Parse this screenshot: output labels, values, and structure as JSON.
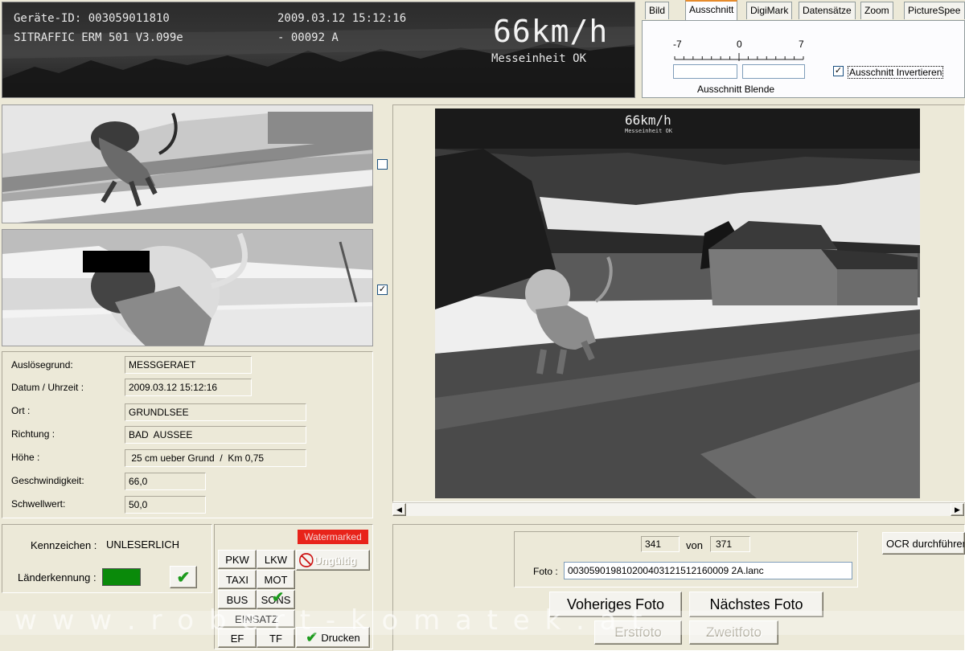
{
  "header_overlay": {
    "device_id": "Geräte-ID: 003059011810",
    "software": "SITRAFFIC ERM 501 V3.099e",
    "datetime": "2009.03.12 15:12:16",
    "counter": "- 00092 A",
    "speed": "66km/h",
    "status": "Messeinheit OK"
  },
  "tabs": [
    "Bild",
    "Ausschnitt",
    "DigiMark",
    "Datensätze",
    "Zoom",
    "PictureSpee"
  ],
  "active_tab": "Ausschnitt",
  "ausschnitt": {
    "scale_min": "-7",
    "scale_mid": "0",
    "scale_max": "7",
    "blende_label": "Ausschnitt Blende",
    "invert_label": "Ausschnitt Invertieren",
    "invert_checked": true
  },
  "crops": [
    {
      "checked": false
    },
    {
      "checked": true
    }
  ],
  "info": {
    "rows": [
      {
        "label": "Auslösegrund:",
        "value": "MESSGERAET"
      },
      {
        "label": "Datum / Uhrzeit :",
        "value": "2009.03.12 15:12:16"
      },
      {
        "label": "Ort :",
        "value": "GRUNDLSEE"
      },
      {
        "label": "Richtung :",
        "value": "BAD  AUSSEE"
      },
      {
        "label": "Höhe :",
        "value": " 25 cm ueber Grund  /  Km 0,75"
      },
      {
        "label": "Geschwindigkeit:",
        "value": "66,0"
      },
      {
        "label": "Schwellwert:",
        "value": "50,0"
      }
    ]
  },
  "plate": {
    "kennzeichen_label": "Kennzeichen :",
    "kennzeichen_value": "UNLESERLICH",
    "laender_label": "Länderkennung :",
    "laender_color": "#0a8a0a"
  },
  "vehicle_buttons": {
    "pkw": "PKW",
    "lkw": "LKW",
    "taxi": "TAXI",
    "mot": "MOT",
    "bus": "BUS",
    "sons": "SONS",
    "einsatz": "EINSATZ",
    "ef": "EF",
    "tf": "TF"
  },
  "watermarked": "Watermarked",
  "ungueltig": "Ungültig",
  "drucken": "Drucken",
  "main_photo_overlay": {
    "speed": "66km/h",
    "status": "Messeinheit OK"
  },
  "navigation": {
    "current": "341",
    "of_label": "von",
    "total": "371",
    "foto_label": "Foto :",
    "foto_value": "003059019810200403121512160009 2A.lanc",
    "prev": "Voheriges Foto",
    "next": "Nächstes Foto",
    "first": "Erstfoto",
    "second": "Zweitfoto",
    "ocr": "OCR durchführen"
  },
  "watermark_text": "w w w . r o b e r t - k o m a t e k . a t",
  "colors": {
    "panel": "#ece9d8",
    "tab_accent": "#e68b2c",
    "watermarked_bg": "#e8231a",
    "check_green": "#1c9a1c"
  }
}
